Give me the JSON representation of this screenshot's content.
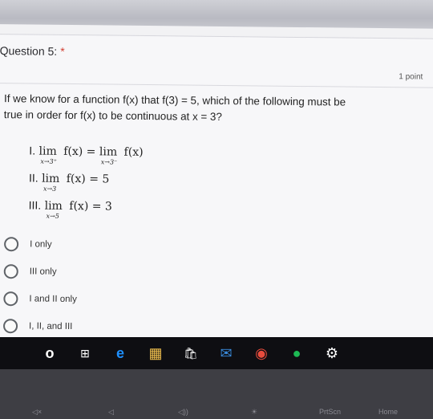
{
  "question": {
    "title": "Question 5:",
    "required_mark": "*",
    "points": "1 point",
    "prompt_line1": "If we know for a function f(x) that f(3) = 5, which of the following must be",
    "prompt_line2": "true in order for f(x) to be continuous at x = 3?",
    "statements": [
      {
        "label": "I.",
        "lim1": "lim",
        "sub1": "x→3⁺",
        "expr1": "f(x) =",
        "lim2": "lim",
        "sub2": "x→3⁻",
        "expr2": "f(x)"
      },
      {
        "label": "II.",
        "lim1": "lim",
        "sub1": "x→3",
        "expr1": "f(x) = 5"
      },
      {
        "label": "III.",
        "lim1": "lim",
        "sub1": "x→5",
        "expr1": "f(x) = 3"
      }
    ],
    "options": [
      "I only",
      "III only",
      "I and II only",
      "I, II, and III"
    ]
  },
  "taskbar": {
    "icons": [
      "o",
      "⊞",
      "e",
      "▦",
      "🛍",
      "✉",
      "◉",
      "●",
      "⚙"
    ]
  },
  "keyboard": {
    "keys": [
      "◁×",
      "◁",
      "◁))",
      "☀",
      "PrtScn",
      "Home"
    ]
  }
}
